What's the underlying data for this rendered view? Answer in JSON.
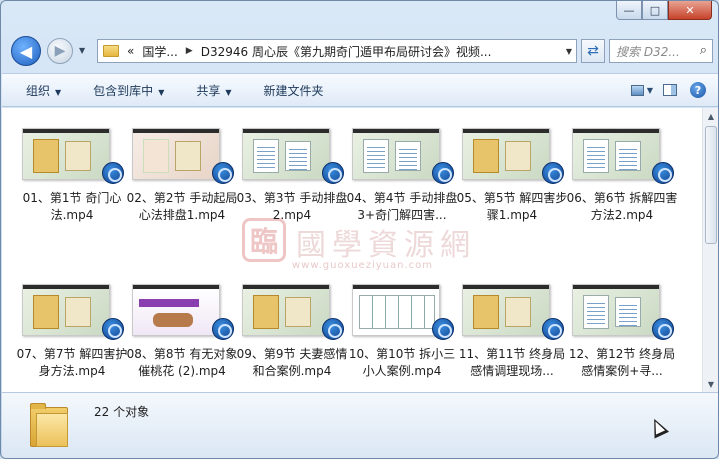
{
  "window": {
    "caption_buttons": [
      "—",
      "□",
      "✕"
    ]
  },
  "nav": {
    "back_icon": "back-arrow-icon",
    "forward_icon": "forward-arrow-icon",
    "address": {
      "prefix": "«",
      "crumb1": "国学...",
      "crumb2": "D32946  周心辰《第九期奇门遁甲布局研讨会》视频..."
    },
    "search_placeholder": "搜索 D32..."
  },
  "toolbar": {
    "organize": "组织",
    "include_in_library": "包含到库中",
    "share": "共享",
    "new_folder": "新建文件夹"
  },
  "watermark": {
    "stamp": "臨",
    "text": "國學資源網",
    "url": "www.guoxueziyuan.com"
  },
  "files": [
    {
      "name": "01、第1节 奇门心法.mp4"
    },
    {
      "name": "02、第2节 手动起局心法排盘1.mp4"
    },
    {
      "name": "03、第3节 手动排盘2.mp4"
    },
    {
      "name": "04、第4节 手动排盘3+奇门解四害..."
    },
    {
      "name": "05、第5节 解四害步骤1.mp4"
    },
    {
      "name": "06、第6节 拆解四害方法2.mp4"
    },
    {
      "name": "07、第7节 解四害护身方法.mp4"
    },
    {
      "name": "08、第8节 有无对象催桃花 (2).mp4"
    },
    {
      "name": "09、第9节 夫妻感情和合案例.mp4"
    },
    {
      "name": "10、第10节 拆小三 小人案例.mp4"
    },
    {
      "name": "11、第11节 终身局感情调理现场..."
    },
    {
      "name": "12、第12节 终身局感情案例+寻..."
    }
  ],
  "status": {
    "count": "22 个对象"
  }
}
